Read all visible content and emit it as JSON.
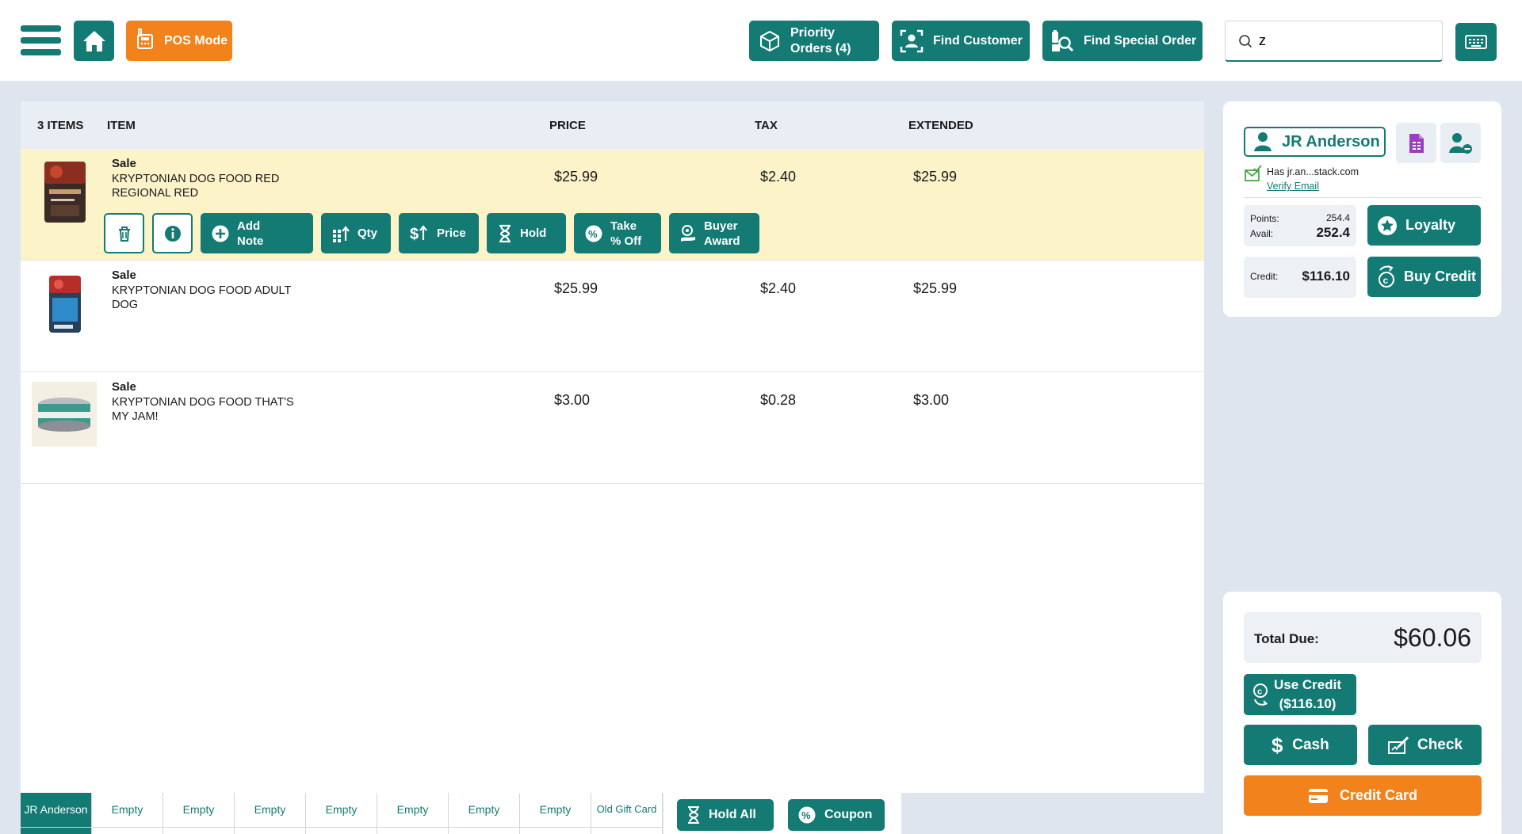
{
  "header": {
    "pos_mode": "POS Mode",
    "priority_orders": "Priority Orders (4)",
    "find_customer": "Find Customer",
    "find_special_order": "Find Special Order",
    "search_value": "z"
  },
  "cart": {
    "columns": {
      "count": "3 ITEMS",
      "item": "ITEM",
      "price": "PRICE",
      "tax": "TAX",
      "extended": "EXTENDED"
    },
    "items": [
      {
        "type": "Sale",
        "name": "KRYPTONIAN DOG FOOD RED REGIONAL RED",
        "price": "$25.99",
        "tax": "$2.40",
        "extended": "$25.99"
      },
      {
        "type": "Sale",
        "name": "KRYPTONIAN DOG FOOD ADULT DOG",
        "price": "$25.99",
        "tax": "$2.40",
        "extended": "$25.99"
      },
      {
        "type": "Sale",
        "name": "KRYPTONIAN DOG FOOD THAT'S MY JAM!",
        "price": "$3.00",
        "tax": "$0.28",
        "extended": "$3.00"
      }
    ],
    "actions": {
      "add_note": "Add Note",
      "qty": "Qty",
      "price": "Price",
      "hold": "Hold",
      "take_off": "Take % Off",
      "buyer_award": "Buyer Award"
    }
  },
  "tabs": [
    "JR Anderson",
    "Empty",
    "Empty",
    "Empty",
    "Empty",
    "Empty",
    "Empty",
    "Empty",
    "Old Gift Card"
  ],
  "tab_actions": {
    "hold_all": "Hold All",
    "coupon": "Coupon"
  },
  "customer": {
    "name": "JR Anderson",
    "email_status": "Has jr.an...stack.com",
    "verify_email": "Verify Email",
    "points_label": "Points:",
    "points_value": "254.4",
    "avail_label": "Avail:",
    "avail_value": "252.4",
    "loyalty": "Loyalty",
    "credit_label": "Credit:",
    "credit_value": "$116.10",
    "buy_credit": "Buy Credit"
  },
  "payment": {
    "total_label": "Total Due:",
    "total_value": "$60.06",
    "use_credit_line1": "Use Credit",
    "use_credit_line2": "($116.10)",
    "cash": "Cash",
    "check": "Check",
    "credit_card": "Credit Card"
  },
  "colors": {
    "primary": "#137a74",
    "accent": "#f2821b",
    "selected_row": "#fcf3c9",
    "background": "#dfe5ee"
  }
}
